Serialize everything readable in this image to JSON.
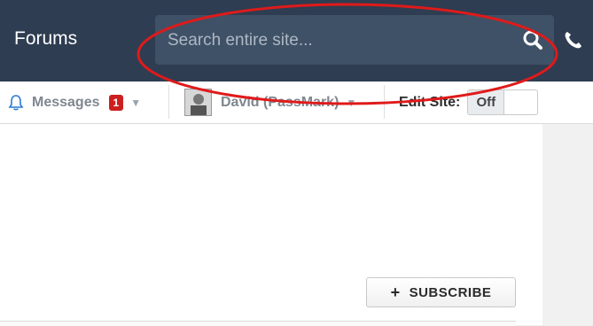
{
  "header": {
    "brand": "Forums",
    "search_placeholder": "Search entire site..."
  },
  "toolbar": {
    "messages_label": "Messages",
    "messages_count": "1",
    "user_name": "David (PassMark)",
    "edit_site_label": "Edit Site:",
    "edit_site_state": "Off"
  },
  "content": {
    "subscribe_label": "SUBSCRIBE",
    "subscribe_icon": "+"
  },
  "colors": {
    "header_bg": "#2e3d51",
    "search_bg": "#3f5166",
    "badge": "#cc1f1f",
    "highlight": "#e01a1a"
  }
}
